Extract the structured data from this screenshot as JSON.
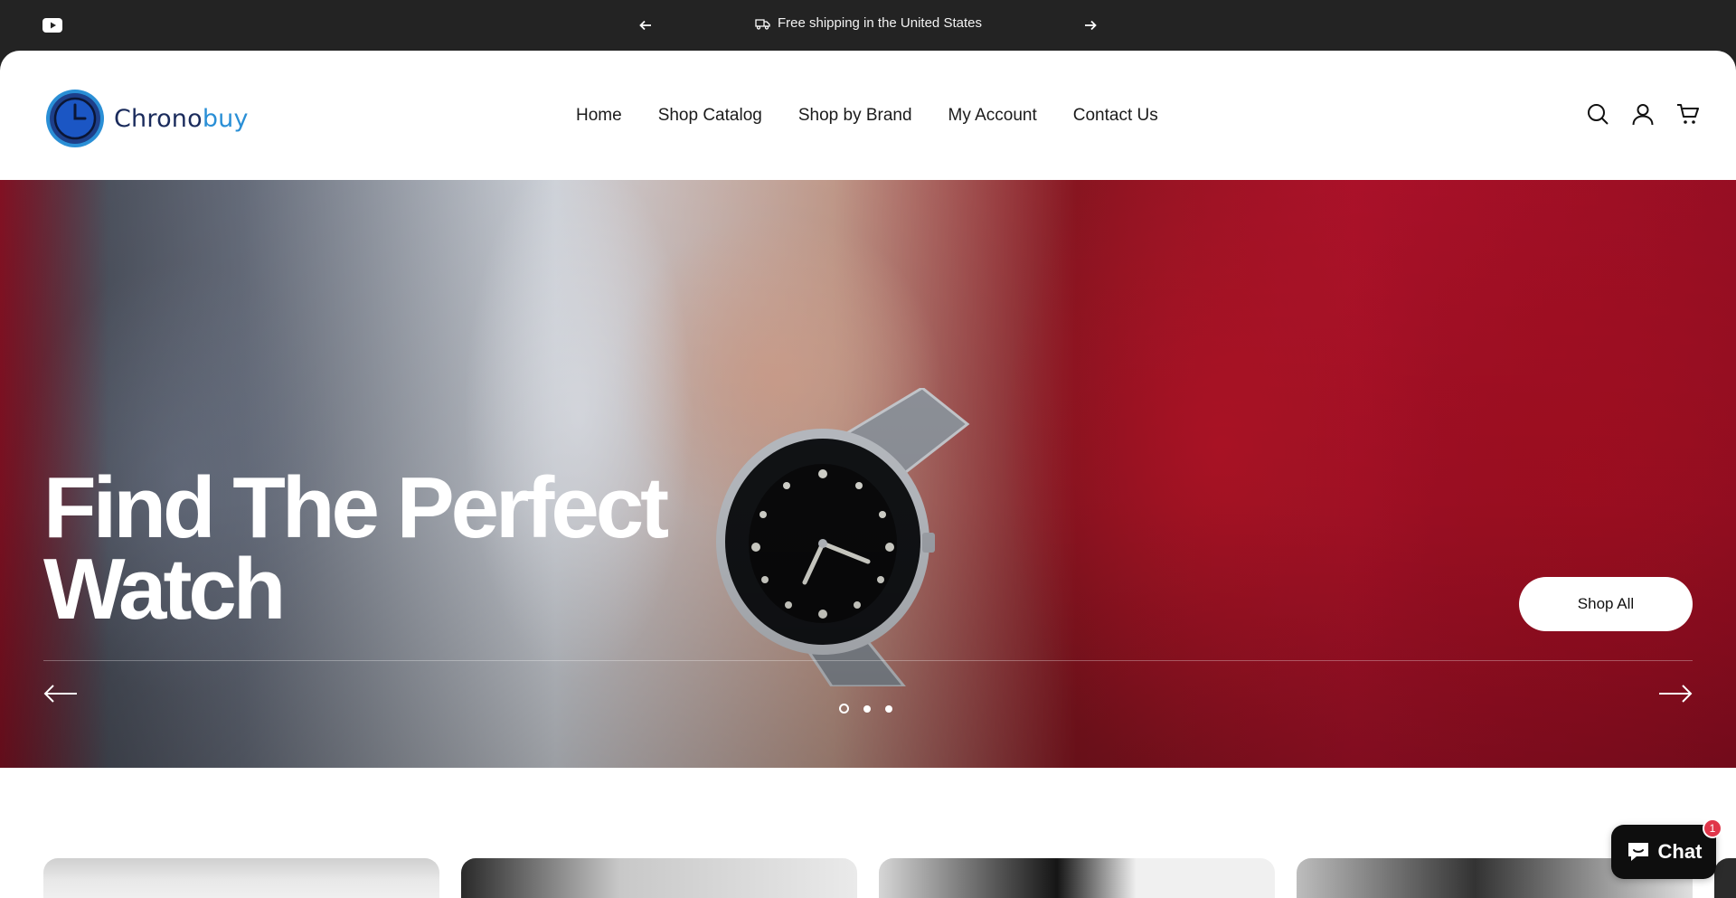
{
  "announcement": {
    "text": "Free shipping in the United States",
    "social": "youtube-icon"
  },
  "header": {
    "logo_part1": "Chrono",
    "logo_part2": "buy",
    "nav": [
      "Home",
      "Shop Catalog",
      "Shop by Brand",
      "My Account",
      "Contact Us"
    ],
    "icons": [
      "search-icon",
      "account-icon",
      "cart-icon"
    ]
  },
  "hero": {
    "title_line1": "Find The Perfect",
    "title_line2": "Watch",
    "cta": "Shop All",
    "slide_count": 3,
    "active_slide": 1
  },
  "chat": {
    "label": "Chat",
    "badge": "1"
  },
  "colors": {
    "topbar": "#232323",
    "accent_blue": "#2a8fd6",
    "chat_badge": "#e0364a"
  }
}
